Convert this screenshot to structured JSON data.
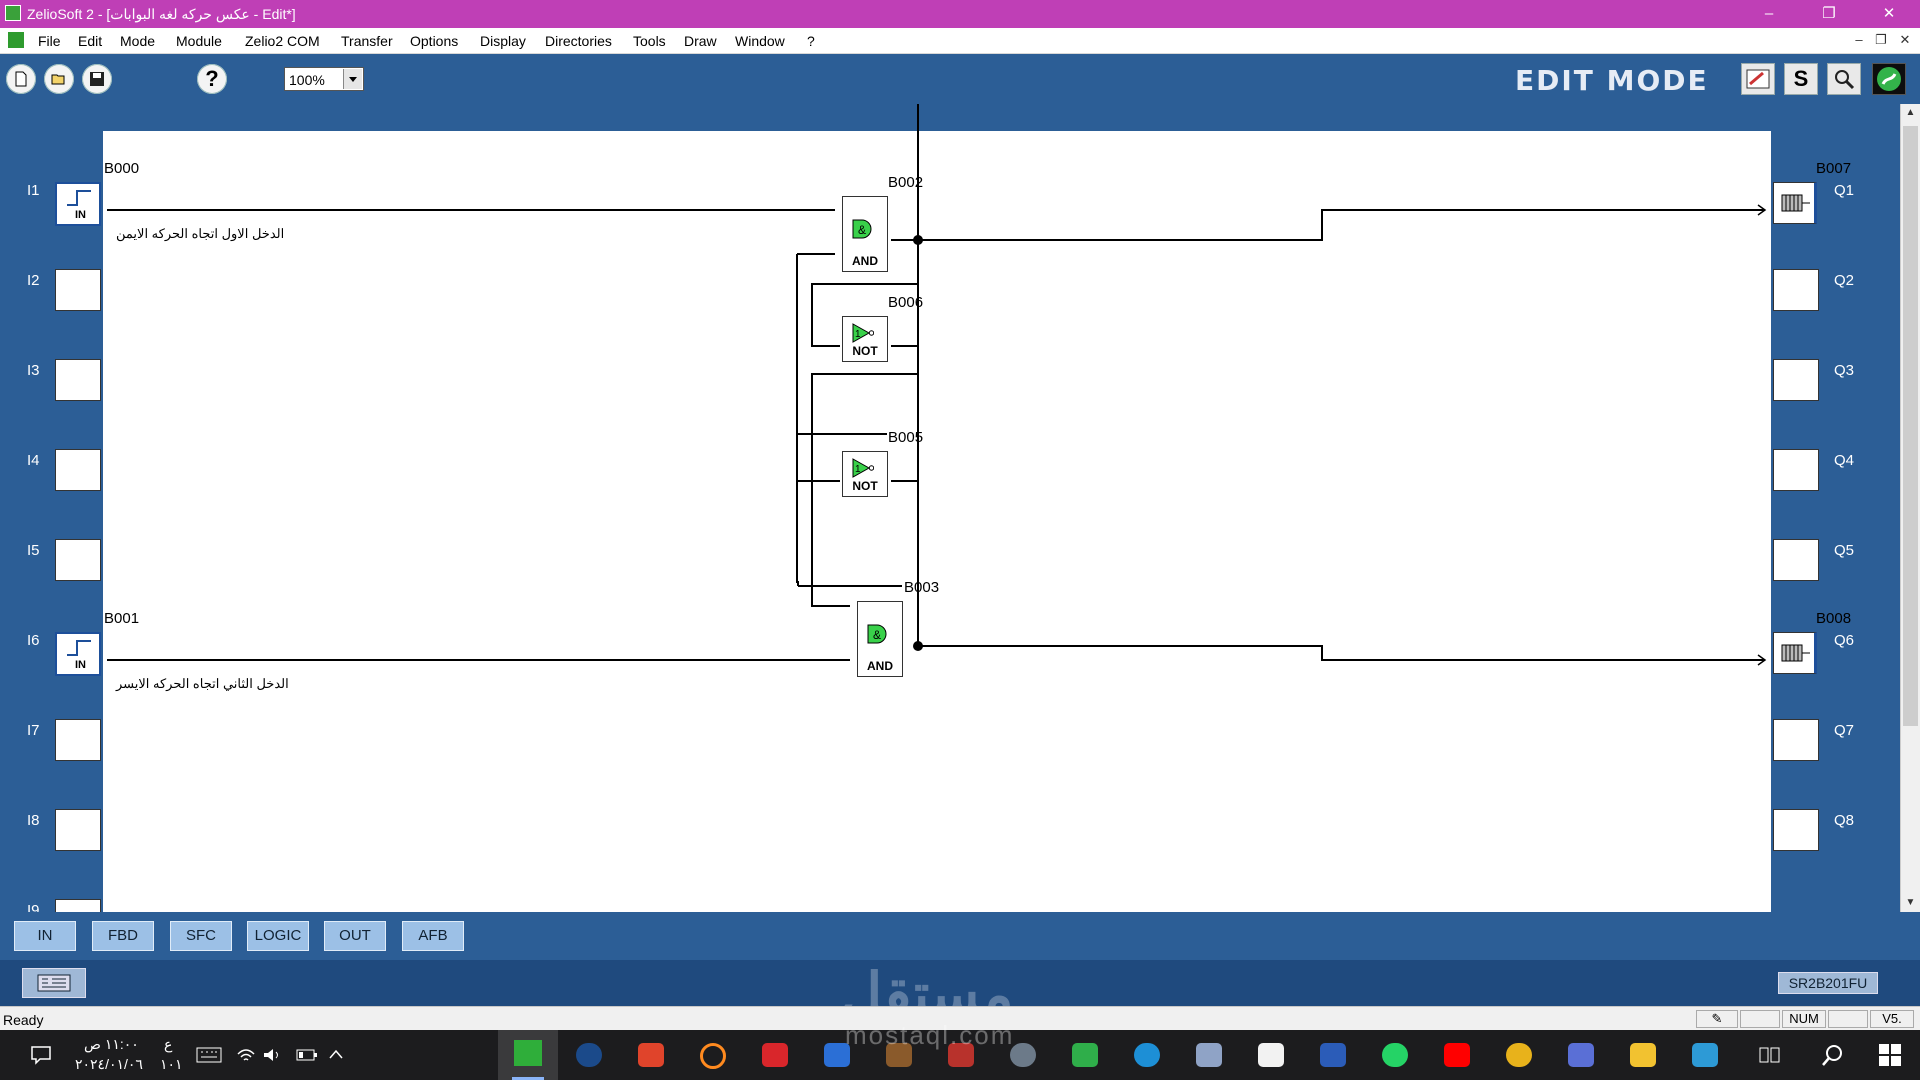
{
  "window": {
    "title": "ZelioSoft 2 - [عكس حركه لغه البوابات - Edit*]",
    "controls": {
      "minimize": "–",
      "restore": "❐",
      "close": "✕"
    }
  },
  "menu": {
    "items": [
      "File",
      "Edit",
      "Mode",
      "Module",
      "Zelio2 COM",
      "Transfer",
      "Options",
      "Display",
      "Directories",
      "Tools",
      "Draw",
      "Window",
      "?"
    ],
    "mdi_controls": {
      "minimize": "–",
      "restore": "❐",
      "close": "✕"
    }
  },
  "toolbar": {
    "zoom": "100%",
    "help_label": "?",
    "mode_label": "EDIT MODE",
    "simulation_label": "S"
  },
  "diagram": {
    "inputs": [
      "I1",
      "I2",
      "I3",
      "I4",
      "I5",
      "I6",
      "I7",
      "I8"
    ],
    "outputs": [
      "Q1",
      "Q2",
      "Q3",
      "Q4",
      "Q5",
      "Q6",
      "Q7",
      "Q8"
    ],
    "partial_input": "I9",
    "blocks": {
      "b000": {
        "name": "B000",
        "label": "IN",
        "comment": "الدخل الاول اتجاه الحركه الايمن"
      },
      "b001": {
        "name": "B001",
        "label": "IN",
        "comment": "الدخل الثاني اتجاه الحركه الايسر"
      },
      "b002": {
        "name": "B002",
        "label": "AND",
        "symbol": "&"
      },
      "b003": {
        "name": "B003",
        "label": "AND",
        "symbol": "&"
      },
      "b005": {
        "name": "B005",
        "label": "NOT",
        "symbol": "1"
      },
      "b006": {
        "name": "B006",
        "label": "NOT",
        "symbol": "1"
      },
      "b007": {
        "name": "B007"
      },
      "b008": {
        "name": "B008"
      }
    }
  },
  "function_tabs": [
    "IN",
    "FBD",
    "SFC",
    "LOGIC",
    "OUT",
    "AFB"
  ],
  "module_ref": "SR2B201FU",
  "watermark": {
    "main": "مستقل",
    "sub": "mostaql.com"
  },
  "status": {
    "ready": "Ready",
    "num": "NUM",
    "version": "V5."
  },
  "taskbar": {
    "time": "١١:٠٠ ص",
    "date": "٢٠٢٤/٠١/٠٦",
    "lang_top": "ع",
    "lang_bottom": "١٠١"
  },
  "colors": {
    "title_bar": "#bf3fb6",
    "panel_blue": "#2c5e96",
    "gate_green": "#39d14a",
    "taskbar": "#1c1c1e"
  }
}
